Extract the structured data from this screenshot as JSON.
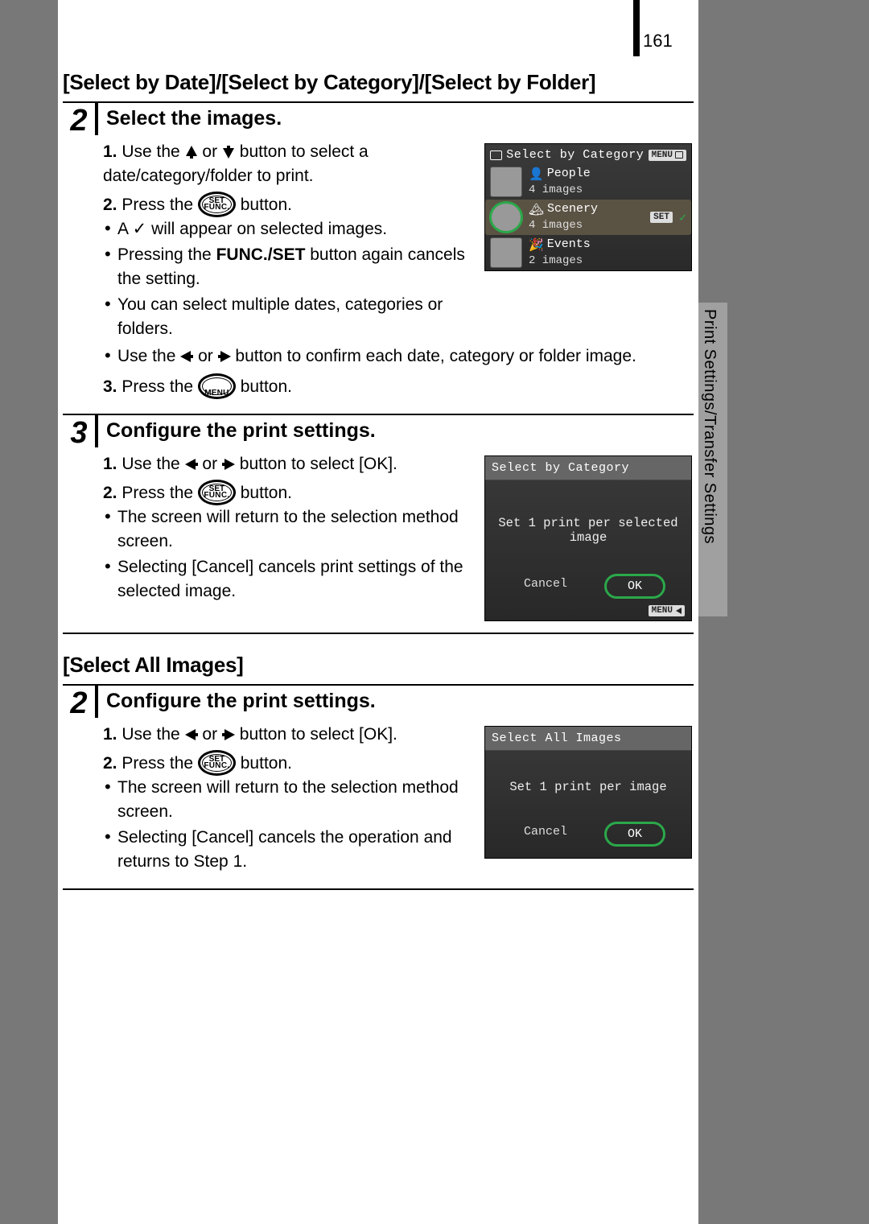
{
  "page_number": "161",
  "side_tab": "Print Settings/Transfer Settings",
  "section1_heading": "[Select by Date]/[Select by Category]/[Select by Folder]",
  "section2_heading": "[Select All Images]",
  "buttons": {
    "func_l1": "FUNC.",
    "func_l2": "SET",
    "menu": "MENU",
    "menu_badge": "MENU",
    "set_badge": "SET"
  },
  "step2a": {
    "num": "2",
    "title": "Select the images.",
    "li1_pre": "Use the ",
    "li1_mid": " or ",
    "li1_post": " button to select a date/category/folder to print.",
    "li2_pre": "Press the ",
    "li2_post": " button.",
    "b1": "A ✓ will appear on selected images.",
    "b2_pre": "Pressing the ",
    "b2_bold": "FUNC./SET",
    "b2_post": " button again cancels the setting.",
    "b3": "You can select multiple dates, categories or folders.",
    "b4_pre": "Use the ",
    "b4_mid": " or ",
    "b4_post": " button to confirm each date, category or folder image.",
    "li3_pre": "Press the ",
    "li3_post": " button."
  },
  "cam1": {
    "title": "Select by Category",
    "rows": [
      {
        "cat": "People",
        "count": "4 images",
        "selected": false
      },
      {
        "cat": "Scenery",
        "count": "4 images",
        "selected": true
      },
      {
        "cat": "Events",
        "count": "2 images",
        "selected": false
      }
    ]
  },
  "step3": {
    "num": "3",
    "title": "Configure the print settings.",
    "li1_pre": "Use the ",
    "li1_mid": " or ",
    "li1_post": " button to select [OK].",
    "li2_pre": "Press the ",
    "li2_post": " button.",
    "b1": "The screen will return to the selection method screen.",
    "b2": "Selecting [Cancel] cancels print settings of the selected image."
  },
  "cam2": {
    "title": "Select by Category",
    "msg": "Set 1 print per selected image",
    "cancel": "Cancel",
    "ok": "OK"
  },
  "step2b": {
    "num": "2",
    "title": "Configure the print settings.",
    "li1_pre": "Use the ",
    "li1_mid": " or ",
    "li1_post": " button to select [OK].",
    "li2_pre": "Press the ",
    "li2_post": " button.",
    "b1": "The screen will return to the selection method screen.",
    "b2": "Selecting [Cancel] cancels the operation and returns to Step 1."
  },
  "cam3": {
    "title": "Select All Images",
    "msg": "Set 1 print per image",
    "cancel": "Cancel",
    "ok": "OK"
  }
}
